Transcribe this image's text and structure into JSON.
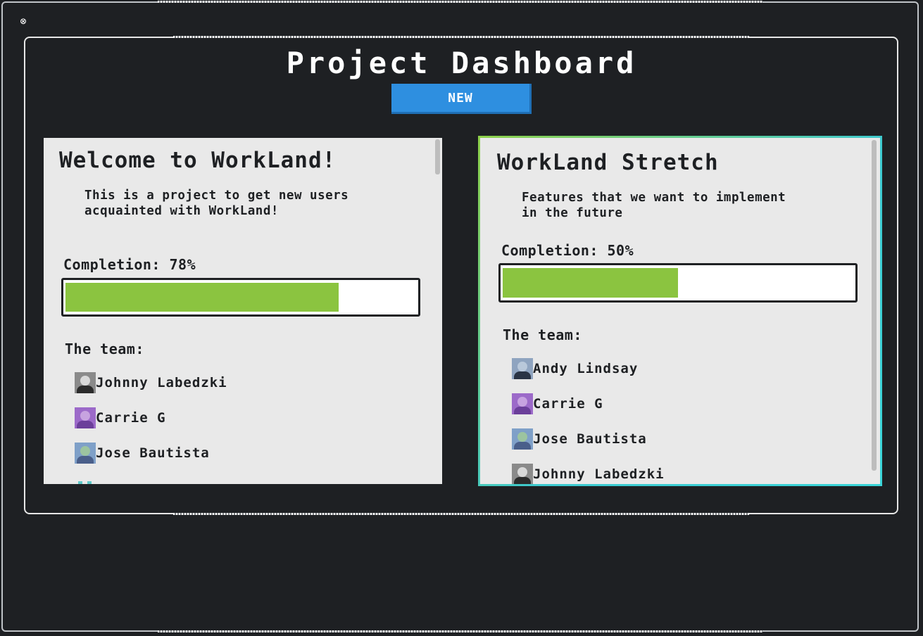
{
  "window": {
    "close_icon": "close-icon"
  },
  "header": {
    "title": "Project Dashboard",
    "new_button_label": "NEW"
  },
  "projects": [
    {
      "title": "Welcome to WorkLand!",
      "description": "This is a project to get new users acquainted with WorkLand!",
      "completion_label": "Completion: 78%",
      "completion": 0.78,
      "team_heading": "The team:",
      "team": [
        {
          "name": "Johnny Labedzki",
          "avatar_colors": [
            "#8a8a8a",
            "#2b2b2b",
            "#d8d8d8"
          ]
        },
        {
          "name": "Carrie G",
          "avatar_colors": [
            "#9c6ac9",
            "#6b3f9a",
            "#c7a3e0"
          ]
        },
        {
          "name": "Jose Bautista",
          "avatar_colors": [
            "#7fa0c8",
            "#4a5f8a",
            "#9cc4a0"
          ]
        }
      ]
    },
    {
      "title": "WorkLand Stretch",
      "description": "Features that we want to implement in the future",
      "completion_label": "Completion: 50%",
      "completion": 0.5,
      "team_heading": "The team:",
      "team": [
        {
          "name": "Andy Lindsay",
          "avatar_colors": [
            "#8fa4c0",
            "#2a3445",
            "#b9c8da"
          ]
        },
        {
          "name": "Carrie G",
          "avatar_colors": [
            "#9c6ac9",
            "#6b3f9a",
            "#c7a3e0"
          ]
        },
        {
          "name": "Jose Bautista",
          "avatar_colors": [
            "#7fa0c8",
            "#4a5f8a",
            "#9cc4a0"
          ]
        },
        {
          "name": "Johnny Labedzki",
          "avatar_colors": [
            "#8a8a8a",
            "#2b2b2b",
            "#d8d8d8"
          ]
        }
      ]
    }
  ],
  "colors": {
    "background": "#1e2023",
    "accent_blue": "#2e8fe0",
    "progress_green": "#8bc440",
    "card_bg": "#e9e9e9",
    "selected_border": "#3cc9d0"
  }
}
